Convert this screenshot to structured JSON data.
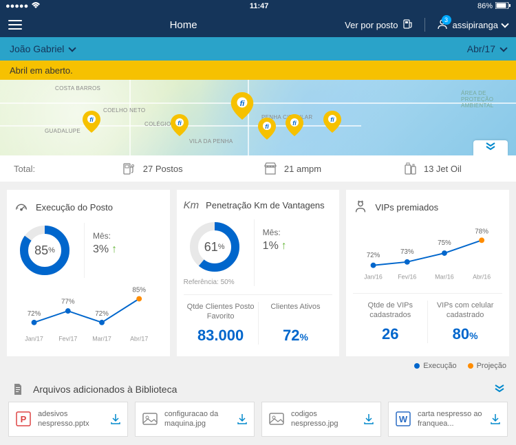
{
  "status": {
    "time": "11:47",
    "battery": "86%"
  },
  "header": {
    "title": "Home",
    "viewByStation": "Ver por posto",
    "username": "assipiranga",
    "notificationCount": "3"
  },
  "subheader": {
    "userName": "João Gabriel",
    "period": "Abr/17"
  },
  "alert": {
    "text": "Abril em aberto."
  },
  "map": {
    "labels": [
      "COSTA BARROS",
      "COELHO NETO",
      "GUADALUPE",
      "COLÉGIO",
      "VILA DA PENHA",
      "PENHA CIRCULAR",
      "ÁREA DE PROTEÇÃO AMBIENTAL"
    ]
  },
  "stats": {
    "totalLabel": "Total:",
    "postos": "27 Postos",
    "ampm": "21 ampm",
    "jetoil": "13 Jet Oil"
  },
  "card1": {
    "title": "Execução do Posto",
    "mainPct": "85",
    "monthLabel": "Mês:",
    "monthPct": "3%"
  },
  "card2": {
    "title": "Penetração Km de Vantagens",
    "mainPct": "61",
    "refText": "Referência: 50%",
    "monthLabel": "Mês:",
    "monthPct": "1%",
    "metric1Label": "Qtde Clientes Posto Favorito",
    "metric1Val": "83.000",
    "metric2Label": "Clientes Ativos",
    "metric2Val": "72"
  },
  "card3": {
    "title": "VIPs premiados",
    "metric1Label": "Qtde de VIPs cadastrados",
    "metric1Val": "26",
    "metric2Label": "VIPs com celular cadastrado",
    "metric2Val": "80"
  },
  "chart_data": [
    {
      "type": "line",
      "title": "Execução do Posto",
      "categories": [
        "Jan/17",
        "Fev/17",
        "Mar/17",
        "Abr/17"
      ],
      "series": [
        {
          "name": "Execução",
          "values": [
            72,
            77,
            72,
            null
          ]
        },
        {
          "name": "Projeção",
          "values": [
            null,
            null,
            null,
            85
          ]
        }
      ],
      "ylim": [
        60,
        90
      ]
    },
    {
      "type": "line",
      "title": "VIPs premiados",
      "categories": [
        "Jan/16",
        "Fev/16",
        "Mar/16",
        "Abr/16"
      ],
      "series": [
        {
          "name": "Execução",
          "values": [
            72,
            73,
            75,
            null
          ]
        },
        {
          "name": "Projeção",
          "values": [
            null,
            null,
            null,
            78
          ]
        }
      ],
      "ylim": [
        65,
        82
      ]
    }
  ],
  "legend": {
    "exec": "Execução",
    "proj": "Projeção"
  },
  "files": {
    "title": "Arquivos adicionados à Biblioteca",
    "items": [
      {
        "name": "adesivos nespresso.pptx",
        "type": "ppt"
      },
      {
        "name": "configuracao da maquina.jpg",
        "type": "img"
      },
      {
        "name": "codigos nespresso.jpg",
        "type": "img"
      },
      {
        "name": "carta nespresso ao franquea...",
        "type": "doc"
      }
    ]
  },
  "colors": {
    "blue": "#0066cc",
    "orange": "#ff8c00",
    "navy": "#15355a",
    "teal": "#2aa3c9",
    "yellow": "#f6c101"
  }
}
